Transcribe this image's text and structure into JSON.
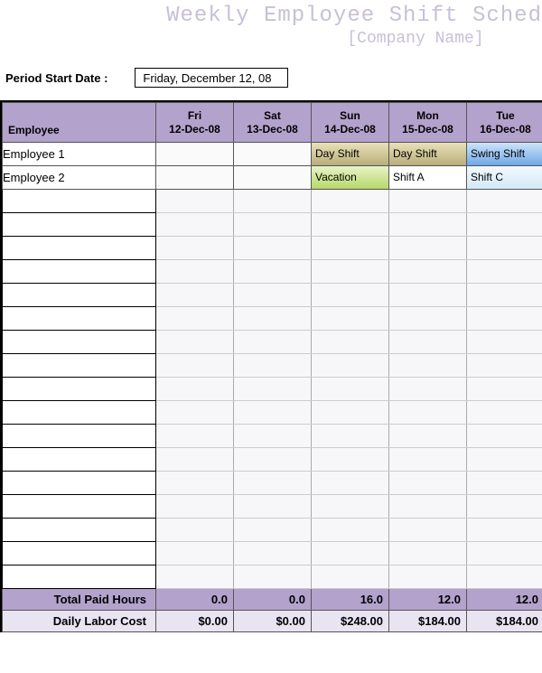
{
  "header": {
    "title": "Weekly Employee Shift Sched",
    "subtitle": "[Company Name]"
  },
  "period": {
    "label": "Period Start Date :",
    "value": "Friday, December 12, 08"
  },
  "columns": {
    "employee_label": "Employee",
    "days": [
      {
        "dow": "Fri",
        "date": "12-Dec-08"
      },
      {
        "dow": "Sat",
        "date": "13-Dec-08"
      },
      {
        "dow": "Sun",
        "date": "14-Dec-08"
      },
      {
        "dow": "Mon",
        "date": "15-Dec-08"
      },
      {
        "dow": "Tue",
        "date": "16-Dec-08"
      }
    ]
  },
  "rows": [
    {
      "employee": "Employee 1",
      "cells": [
        "",
        "",
        "Day Shift",
        "Day Shift",
        "Swing Shift"
      ]
    },
    {
      "employee": "Employee 2",
      "cells": [
        "",
        "",
        "Vacation",
        "Shift A",
        "Shift C"
      ]
    }
  ],
  "empty_rows": 17,
  "totals": {
    "paid_hours_label": "Total Paid Hours",
    "paid_hours": [
      "0.0",
      "0.0",
      "16.0",
      "12.0",
      "12.0"
    ],
    "labor_cost_label": "Daily Labor Cost",
    "labor_cost": [
      "$0.00",
      "$0.00",
      "$248.00",
      "$184.00",
      "$184.00"
    ]
  },
  "shift_colors": {
    "Day Shift": "DayShift",
    "Swing Shift": "SwingShift",
    "Vacation": "Vacation",
    "Shift A": "ShiftA",
    "Shift C": "ShiftC"
  }
}
